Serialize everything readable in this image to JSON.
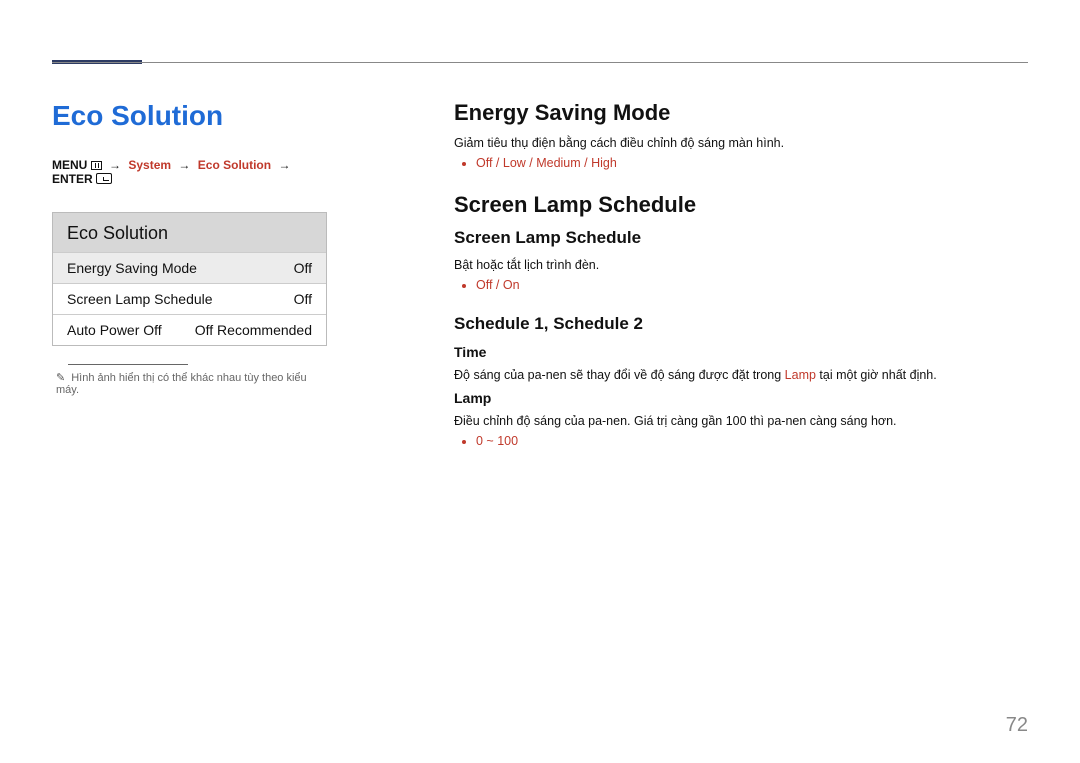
{
  "pageNumber": "72",
  "left": {
    "title": "Eco Solution",
    "breadcrumb": {
      "menu": "MENU",
      "system": "System",
      "eco": "Eco Solution",
      "enter": "ENTER"
    },
    "panel": {
      "header": "Eco Solution",
      "rows": [
        {
          "label": "Energy Saving Mode",
          "value": "Off"
        },
        {
          "label": "Screen Lamp Schedule",
          "value": "Off"
        },
        {
          "label": "Auto Power Off",
          "value": "Off Recommended"
        }
      ]
    },
    "note": "Hình ảnh hiển thị có thể khác nhau tùy theo kiểu máy."
  },
  "right": {
    "energy": {
      "title": "Energy Saving Mode",
      "desc": "Giảm tiêu thụ điện bằng cách điều chỉnh độ sáng màn hình.",
      "options": "Off / Low / Medium / High"
    },
    "lamp": {
      "title": "Screen Lamp Schedule",
      "sub": "Screen Lamp Schedule",
      "desc": "Bật hoặc tắt lịch trình đèn.",
      "options": "Off / On"
    },
    "schedule": {
      "title": "Schedule 1, Schedule 2",
      "time": {
        "label": "Time",
        "desc_a": "Độ sáng của pa-nen sẽ thay đổi về độ sáng được đặt trong ",
        "desc_accent": "Lamp",
        "desc_b": " tại một giờ nhất định."
      },
      "lampv": {
        "label": "Lamp",
        "desc": "Điều chỉnh độ sáng của pa-nen. Giá trị càng gần 100 thì pa-nen càng sáng hơn.",
        "range": "0 ~ 100"
      }
    }
  }
}
